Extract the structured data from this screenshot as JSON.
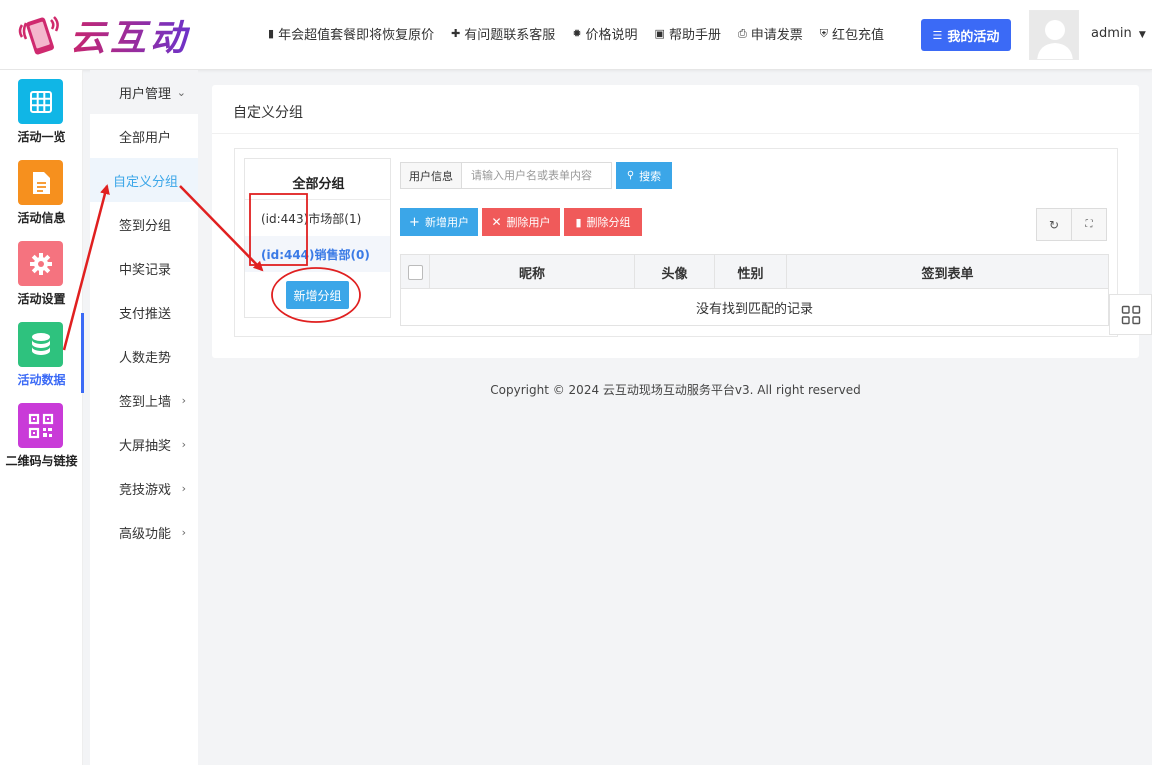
{
  "header": {
    "logo_text": "云互动",
    "nav": [
      {
        "icon": "document-icon",
        "label": "年会超值套餐即将恢复原价"
      },
      {
        "icon": "user-plus-icon",
        "label": "有问题联系客服"
      },
      {
        "icon": "badge-icon",
        "label": "价格说明"
      },
      {
        "icon": "book-icon",
        "label": "帮助手册"
      },
      {
        "icon": "printer-icon",
        "label": "申请发票"
      },
      {
        "icon": "shield-icon",
        "label": "红包充值"
      }
    ],
    "my_activity_label": "我的活动",
    "username": "admin",
    "accent_color": "#3b6af6"
  },
  "iconbar": {
    "items": [
      {
        "label": "活动一览",
        "icon": "grid-icon",
        "color": "#10b6e6"
      },
      {
        "label": "活动信息",
        "icon": "file-icon",
        "color": "#f6901e"
      },
      {
        "label": "活动设置",
        "icon": "gear-icon",
        "color": "#f5737f"
      },
      {
        "label": "活动数据",
        "icon": "database-icon",
        "color": "#2ec27e",
        "active": true
      },
      {
        "label": "二维码与链接",
        "icon": "qrcode-icon",
        "color": "#c93bd8"
      }
    ]
  },
  "subnav": {
    "header": "用户管理",
    "items": [
      {
        "label": "全部用户"
      },
      {
        "label": "自定义分组",
        "active": true
      },
      {
        "label": "签到分组"
      },
      {
        "label": "中奖记录"
      },
      {
        "label": "支付推送"
      },
      {
        "label": "人数走势"
      },
      {
        "label": "签到上墙",
        "has_children": true
      },
      {
        "label": "大屏抽奖",
        "has_children": true
      },
      {
        "label": "竞技游戏",
        "has_children": true
      },
      {
        "label": "高级功能",
        "has_children": true
      }
    ]
  },
  "main": {
    "title": "自定义分组",
    "groups": {
      "title": "全部分组",
      "items": [
        {
          "label": "(id:443)市场部(1)"
        },
        {
          "label": "(id:444)销售部(0)",
          "selected": true
        }
      ],
      "add_label": "新增分组"
    },
    "search": {
      "label": "用户信息",
      "placeholder": "请输入用户名或表单内容",
      "button": "搜索"
    },
    "actions": {
      "add_user": "新增用户",
      "delete_user": "删除用户",
      "delete_group": "删除分组"
    },
    "table": {
      "columns": [
        "昵称",
        "头像",
        "性别",
        "签到表单"
      ],
      "empty_text": "没有找到匹配的记录"
    }
  },
  "footer": {
    "copyright": "Copyright © 2024 云互动现场互动服务平台v3. All right reserved"
  }
}
